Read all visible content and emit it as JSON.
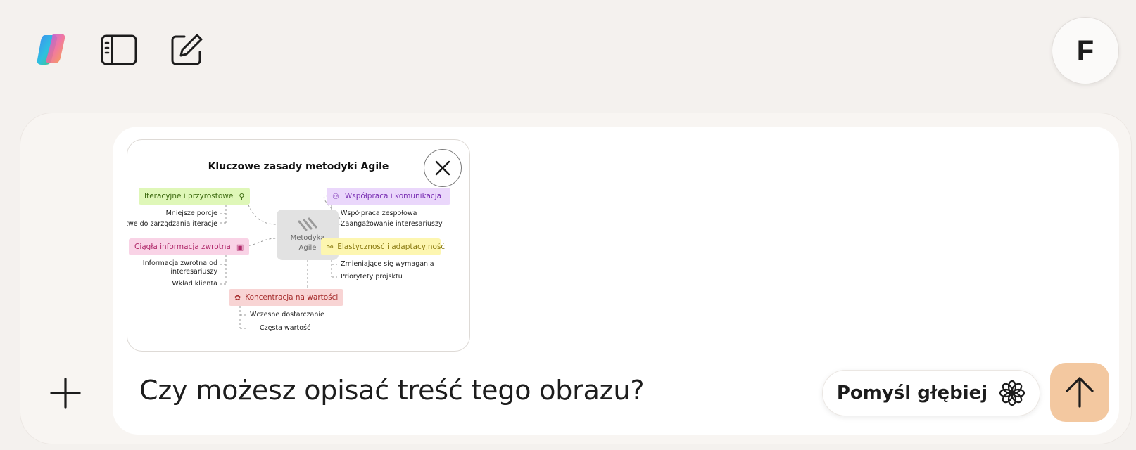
{
  "topbar": {
    "logo_icon": "copilot-logo-icon",
    "sidebar_icon": "sidebar-toggle-icon",
    "new_chat_icon": "new-chat-icon",
    "avatar_initial": "F"
  },
  "composer": {
    "attach_icon": "plus-icon",
    "prompt_text": "Czy możesz opisać treść tego obrazu?",
    "think_label": "Pomyśl głębiej",
    "think_icon": "flower-icon",
    "send_icon": "arrow-up-icon",
    "accent_color": "#f3c8a0"
  },
  "attachment": {
    "close_icon": "close-icon",
    "mindmap": {
      "title": "Kluczowe zasady metodyki Agile",
      "center": [
        "Metodyka",
        "Agile"
      ],
      "branches": [
        {
          "label": "Iteracyjne i przyrostowe",
          "color": "#dff7b8",
          "text_color": "#3d6b10",
          "leaves": [
            "Mniejsze porcje",
            "Łatwe do zarządzania iteracje"
          ]
        },
        {
          "label": "Ciągła informacja zwrotna",
          "color": "#f9d3e6",
          "text_color": "#b0286a",
          "leaves": [
            "Informacja zwrotna od",
            "interesariuszy",
            "Wkład klienta"
          ]
        },
        {
          "label": "Współpraca i komunikacja",
          "color": "#ead7fb",
          "text_color": "#7a2fb3",
          "leaves": [
            "Współpraca zespołowa",
            "Zaangażowanie interesariuszy"
          ]
        },
        {
          "label": "Elastyczność i adaptacyjność",
          "color": "#fdf6b0",
          "text_color": "#8a7a10",
          "leaves": [
            "Zmieniające się wymagania",
            "Priorytety projsktu"
          ]
        },
        {
          "label": "Koncentracja na wartości",
          "color": "#f8d4d4",
          "text_color": "#a52b2b",
          "leaves": [
            "Wczesne dostarczanie",
            "Częsta wartość"
          ]
        }
      ]
    }
  }
}
